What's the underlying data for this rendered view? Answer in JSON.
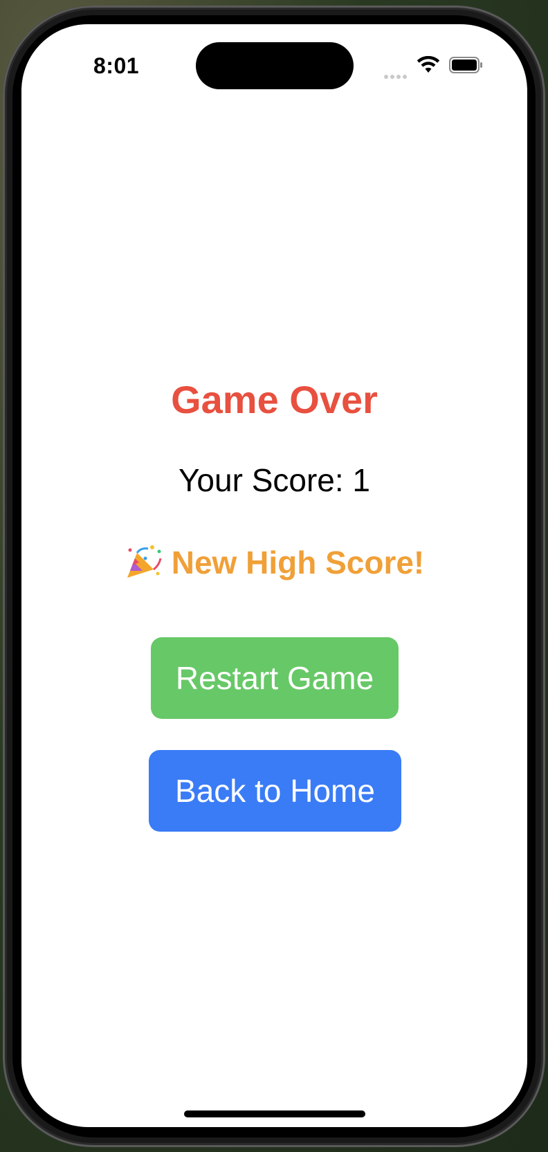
{
  "status_bar": {
    "time": "8:01",
    "icons": [
      "signal-dots-icon",
      "wifi-icon",
      "battery-icon"
    ]
  },
  "game_over": {
    "title": "Game Over",
    "score_text": "Your Score: 1",
    "high_score_emoji": "party-popper-icon",
    "high_score_text": "New High Score!"
  },
  "buttons": {
    "restart_label": "Restart Game",
    "home_label": "Back to Home"
  },
  "colors": {
    "title": "#e8503f",
    "high_score": "#f0a038",
    "restart_button": "#67c867",
    "home_button": "#3a7cf6",
    "background": "#ffffff"
  }
}
